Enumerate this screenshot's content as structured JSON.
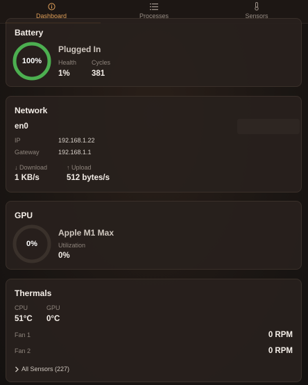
{
  "tabs": [
    {
      "label": "Dashboard",
      "icon": "info-icon",
      "active": true
    },
    {
      "label": "Processes",
      "icon": "list-icon",
      "active": false
    },
    {
      "label": "Sensors",
      "icon": "thermometer-icon",
      "active": false
    }
  ],
  "battery": {
    "title": "Battery",
    "percent": "100%",
    "level": 1.0,
    "status": "Plugged In",
    "health_label": "Health",
    "health_value": "1%",
    "cycles_label": "Cycles",
    "cycles_value": "381",
    "ring_color": "#4caf50"
  },
  "network": {
    "title": "Network",
    "interface": "en0",
    "ip_label": "IP",
    "ip_value": "192.168.1.22",
    "gateway_label": "Gateway",
    "gateway_value": "192.168.1.1",
    "download_label": "↓ Download",
    "download_value": "1 KB/s",
    "upload_label": "↑ Upload",
    "upload_value": "512 bytes/s"
  },
  "gpu": {
    "title": "GPU",
    "percent": "0%",
    "level": 0.0,
    "name": "Apple M1 Max",
    "utilization_label": "Utilization",
    "utilization_value": "0%"
  },
  "thermals": {
    "title": "Thermals",
    "cpu_label": "CPU",
    "cpu_value": "51°C",
    "gpu_label": "GPU",
    "gpu_value": "0°C",
    "fan1_label": "Fan 1",
    "fan1_value": "0 RPM",
    "fan2_label": "Fan 2",
    "fan2_value": "0 RPM",
    "sensors_label": "All Sensors (227)"
  },
  "colors": {
    "accent": "#d8913f",
    "background": "#1b1613",
    "card": "#28211d"
  }
}
